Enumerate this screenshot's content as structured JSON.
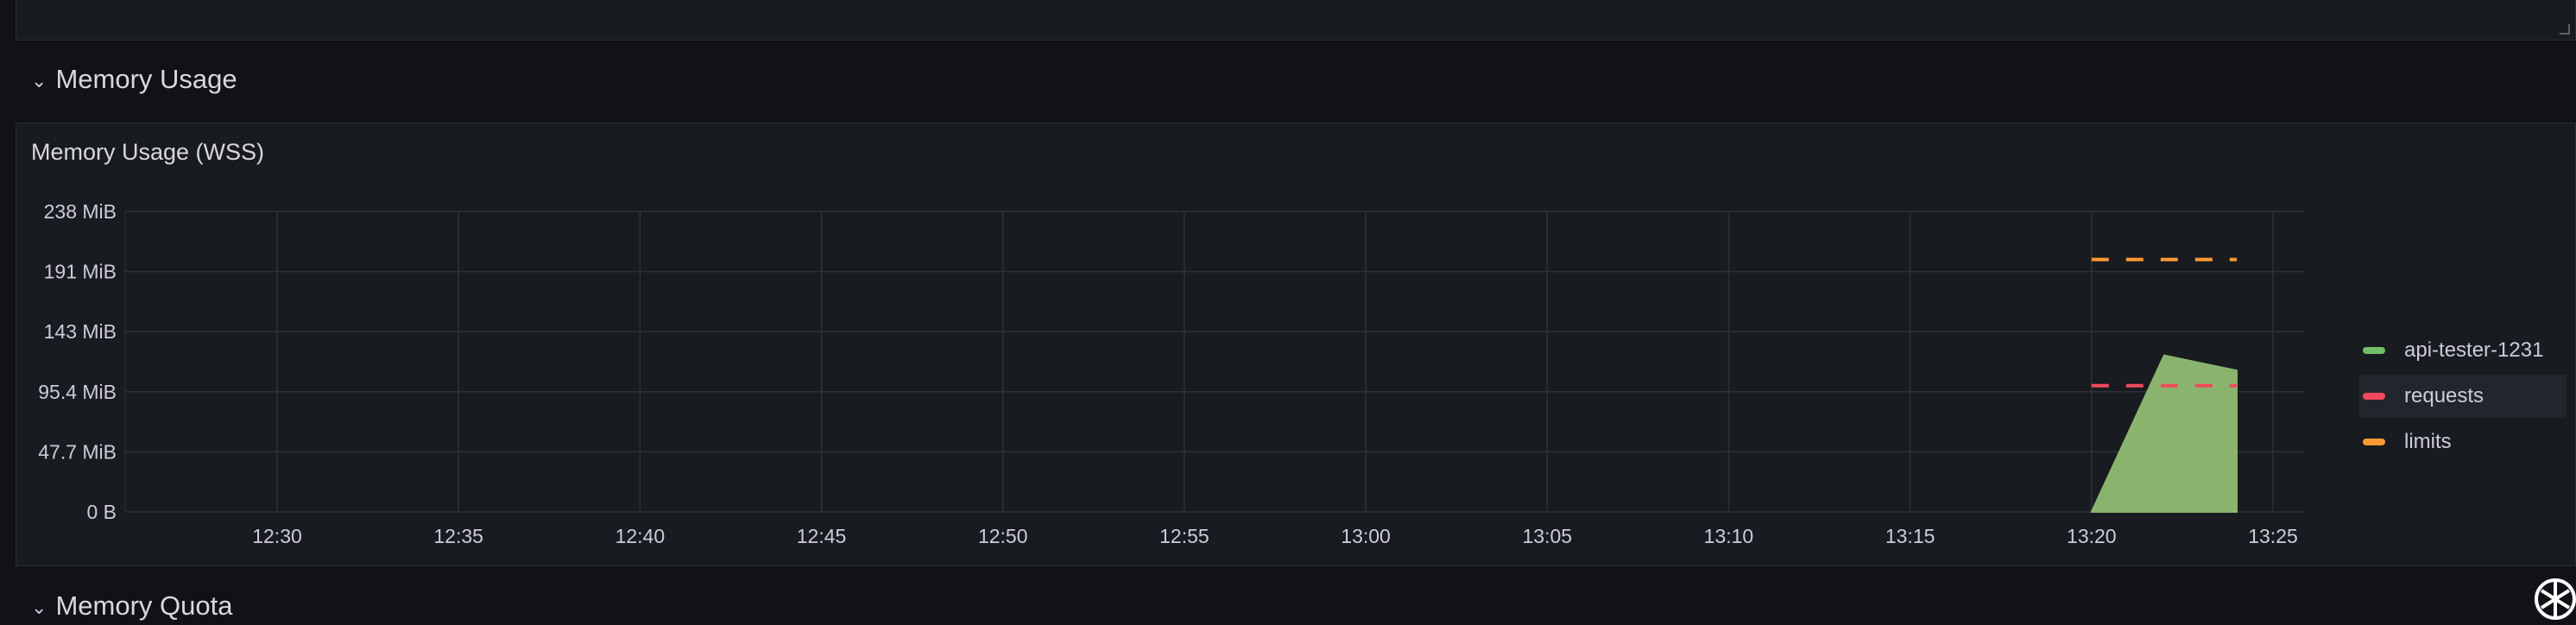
{
  "rows": [
    {
      "title": "Memory Usage"
    },
    {
      "title": "Memory Quota"
    }
  ],
  "panel": {
    "title": "Memory Usage (WSS)"
  },
  "colors": {
    "background": "#111217",
    "panel": "#181b1f",
    "grid": "#2e3138",
    "api_tester": "#8ab46e",
    "requests": "#f2495c",
    "limits": "#ff9830"
  },
  "legend": [
    {
      "name": "api-tester-1231",
      "color": "#73bf69"
    },
    {
      "name": "requests",
      "color": "#f2495c"
    },
    {
      "name": "limits",
      "color": "#ff9830"
    }
  ],
  "chart_data": {
    "type": "area",
    "title": "Memory Usage (WSS)",
    "xlabel": "",
    "ylabel": "",
    "x_ticks": [
      "12:30",
      "12:35",
      "12:40",
      "12:45",
      "12:50",
      "12:55",
      "13:00",
      "13:05",
      "13:10",
      "13:15",
      "13:20",
      "13:25"
    ],
    "y_ticks": [
      "0 B",
      "47.7 MiB",
      "95.4 MiB",
      "143 MiB",
      "191 MiB",
      "238 MiB"
    ],
    "xlim": [
      "12:26",
      "13:26"
    ],
    "ylim": [
      0,
      238
    ],
    "y_unit": "MiB",
    "grid": true,
    "legend_position": "right",
    "series": [
      {
        "name": "api-tester-1231",
        "style": "area",
        "x": [
          "13:20",
          "13:22",
          "13:24"
        ],
        "y": [
          0,
          124,
          112
        ]
      },
      {
        "name": "requests",
        "style": "dashed",
        "x": [
          "13:20",
          "13:24"
        ],
        "y": [
          100,
          100
        ]
      },
      {
        "name": "limits",
        "style": "dashed",
        "x": [
          "13:20",
          "13:24"
        ],
        "y": [
          200,
          200
        ]
      }
    ]
  },
  "icons": {
    "logo": "grafana-cloud-logo-icon",
    "row_toggle": "chevron-down-icon"
  }
}
